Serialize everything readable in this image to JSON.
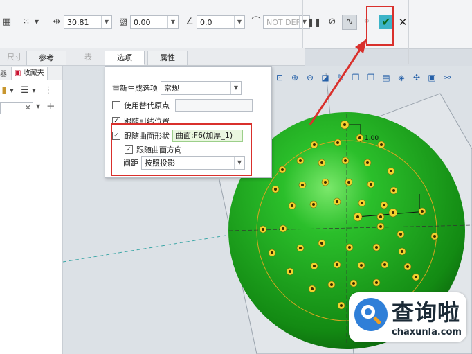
{
  "toolbar": {
    "value1": "30.81",
    "value2": "0.00",
    "value3": "0.0",
    "value4": "NOT DEFI",
    "pause_icon": "pause-icon",
    "confirm_icon": "checkmark-icon",
    "cancel_icon": "close-icon"
  },
  "tabs": [
    {
      "label": "尺寸"
    },
    {
      "label": "参考"
    },
    {
      "label": "表"
    },
    {
      "label": "选项"
    },
    {
      "label": "属性"
    }
  ],
  "left_panel": {
    "tab_label": "收藏夹"
  },
  "options_panel": {
    "regen_label": "重新生成选项",
    "regen_value": "常规",
    "alt_origin_label": "使用替代原点",
    "follow_leader_label": "跟随引线位置",
    "follow_surface_label": "跟随曲面形状",
    "surface_value": "曲面:F6(加厚_1)",
    "follow_dir_label": "跟随曲面方向",
    "spacing_label": "间距",
    "spacing_value": "按照投影"
  },
  "viewport": {
    "dim_label": "1.00"
  },
  "watermark": {
    "brand_cn": "查询啦",
    "brand_url": "chaxunla.com"
  },
  "colors": {
    "sphere": "#1e9e1e",
    "highlight": "#d9302c",
    "accent": "#2f7fd8",
    "check": "#1aa84a"
  }
}
